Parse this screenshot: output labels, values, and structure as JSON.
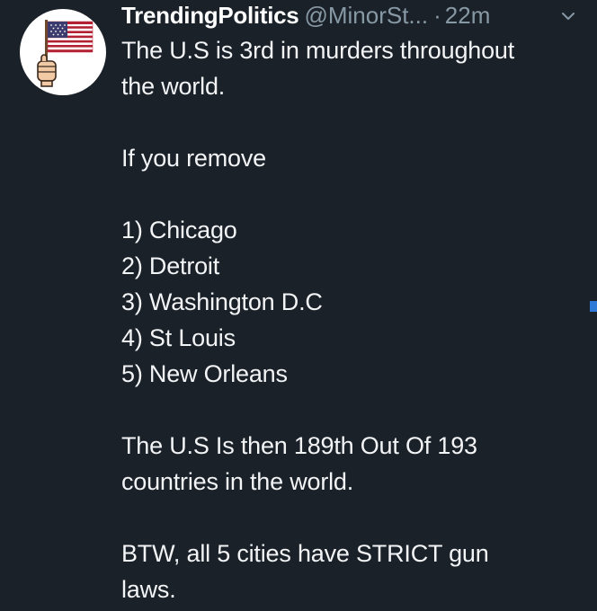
{
  "tweet": {
    "display_name": "TrendingPolitics",
    "handle": "@MinorSt...",
    "separator": "·",
    "time": "22m",
    "caret_icon": "chevron-down-icon",
    "avatar_icon": "flag-fist-icon",
    "line1": "The U.S is 3rd in murders throughout",
    "line2": "the world.",
    "remove_intro": "If you remove",
    "cities": [
      "1) Chicago",
      "2) Detroit",
      "3) Washington D.C",
      "4) St Louis",
      "5) New Orleans"
    ],
    "result_line1": "The U.S Is then 189th Out Of 193",
    "result_line2": "countries in the world.",
    "btw_line1": "BTW, all 5 cities have STRICT gun",
    "btw_line2": "laws."
  },
  "colors": {
    "background": "#1b2129",
    "text": "#ffffff",
    "muted": "#8899a6"
  }
}
